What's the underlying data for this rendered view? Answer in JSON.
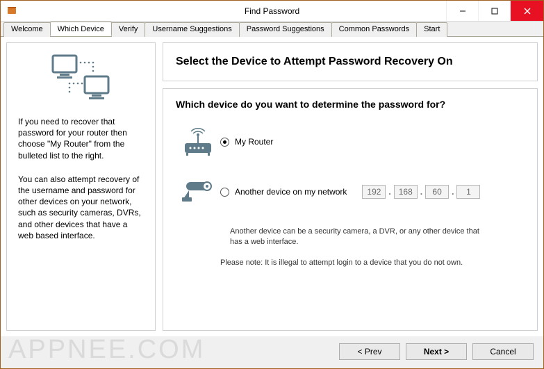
{
  "window": {
    "title": "Find Password"
  },
  "tabs": [
    {
      "label": "Welcome"
    },
    {
      "label": "Which Device"
    },
    {
      "label": "Verify"
    },
    {
      "label": "Username Suggestions"
    },
    {
      "label": "Password Suggestions"
    },
    {
      "label": "Common Passwords"
    },
    {
      "label": "Start"
    }
  ],
  "active_tab": 1,
  "left": {
    "para1": "If you need to recover that password for your router then choose \"My Router\" from the bulleted list to the right.",
    "para2": "You can also attempt recovery of the username and password for other devices on your network, such as security cameras, DVRs, and other devices that have a web based interface."
  },
  "right": {
    "heading": "Select the Device to Attempt Password Recovery On",
    "question": "Which device do you want to determine the password for?",
    "opt1_label": "My Router",
    "opt2_label": "Another device on my network",
    "ip": [
      "192",
      "168",
      "60",
      "1"
    ],
    "note1": "Another device can be a security camera, a DVR, or any other device that has a web interface.",
    "note2": "Please note: It is illegal to attempt login to a device that you do not own."
  },
  "buttons": {
    "prev": "< Prev",
    "next": "Next >",
    "cancel": "Cancel"
  },
  "watermark": "APPNEE.COM"
}
